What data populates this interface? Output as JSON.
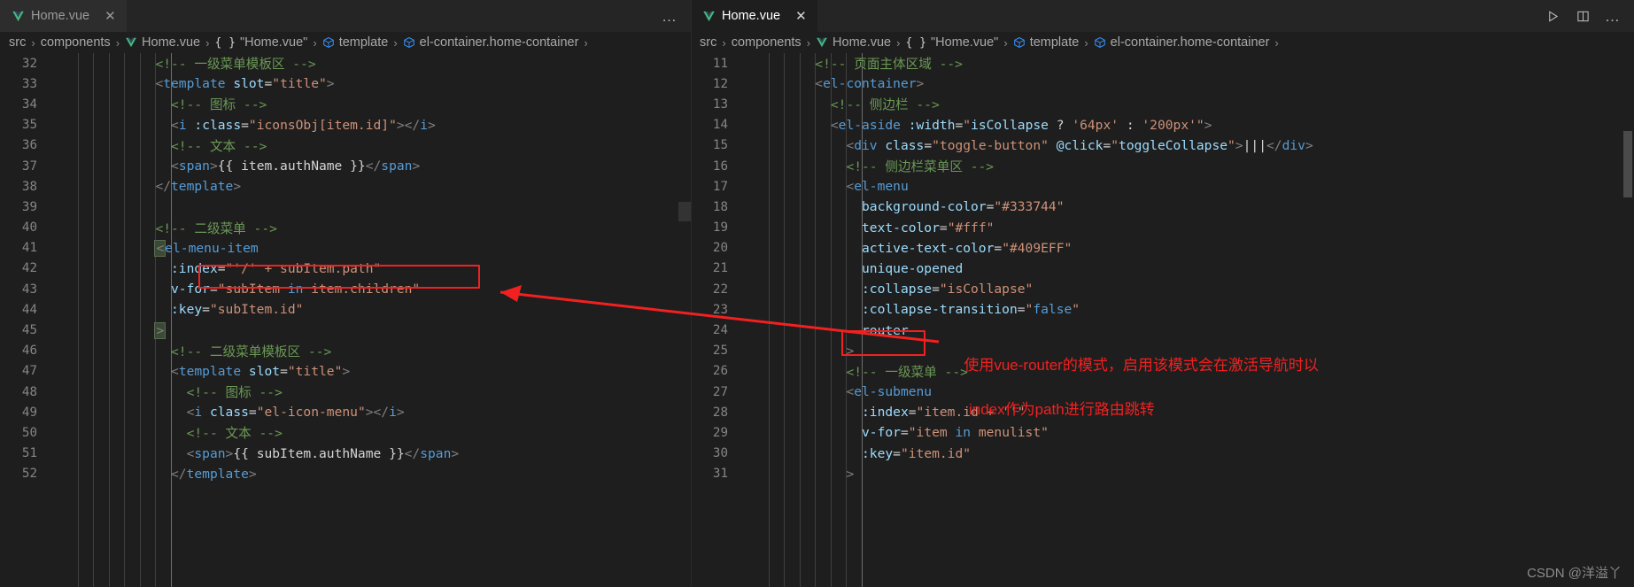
{
  "window": {
    "watermark": "CSDN @洋溢丫"
  },
  "left_group": {
    "tab": {
      "label": "Home.vue",
      "icon": "vue-icon",
      "close": "✕",
      "active": false
    },
    "overflow_dots": "…",
    "breadcrumbs": [
      {
        "label": "src",
        "icon": ""
      },
      {
        "label": "components",
        "icon": ""
      },
      {
        "label": "Home.vue",
        "icon": "vue-icon"
      },
      {
        "label": "\"Home.vue\"",
        "icon": "braces-icon"
      },
      {
        "label": "template",
        "icon": "cube-icon"
      },
      {
        "label": "el-container.home-container",
        "icon": "cube-icon"
      }
    ],
    "breadcrumb_separator": "›",
    "lines": [
      {
        "no": "32",
        "indent": 6,
        "tokens": [
          {
            "t": "comment",
            "s": "<!-- 一级菜单模板区 -->"
          }
        ]
      },
      {
        "no": "33",
        "indent": 6,
        "tokens": [
          {
            "t": "punct",
            "s": "<"
          },
          {
            "t": "tag",
            "s": "template"
          },
          {
            "t": "plain",
            "s": " "
          },
          {
            "t": "attr",
            "s": "slot"
          },
          {
            "t": "op",
            "s": "="
          },
          {
            "t": "str",
            "s": "\"title\""
          },
          {
            "t": "punct",
            "s": ">"
          }
        ]
      },
      {
        "no": "34",
        "indent": 7,
        "tokens": [
          {
            "t": "comment",
            "s": "<!-- 图标 -->"
          }
        ]
      },
      {
        "no": "35",
        "indent": 7,
        "tokens": [
          {
            "t": "punct",
            "s": "<"
          },
          {
            "t": "tag",
            "s": "i"
          },
          {
            "t": "plain",
            "s": " "
          },
          {
            "t": "attr",
            "s": ":class"
          },
          {
            "t": "op",
            "s": "="
          },
          {
            "t": "str",
            "s": "\"iconsObj[item.id]\""
          },
          {
            "t": "punct",
            "s": "></"
          },
          {
            "t": "tag",
            "s": "i"
          },
          {
            "t": "punct",
            "s": ">"
          }
        ]
      },
      {
        "no": "36",
        "indent": 7,
        "tokens": [
          {
            "t": "comment",
            "s": "<!-- 文本 -->"
          }
        ]
      },
      {
        "no": "37",
        "indent": 7,
        "tokens": [
          {
            "t": "punct",
            "s": "<"
          },
          {
            "t": "tag",
            "s": "span"
          },
          {
            "t": "punct",
            "s": ">"
          },
          {
            "t": "plain",
            "s": "{{ item.authName }}"
          },
          {
            "t": "punct",
            "s": "</"
          },
          {
            "t": "tag",
            "s": "span"
          },
          {
            "t": "punct",
            "s": ">"
          }
        ]
      },
      {
        "no": "38",
        "indent": 6,
        "tokens": [
          {
            "t": "punct",
            "s": "</"
          },
          {
            "t": "tag",
            "s": "template"
          },
          {
            "t": "punct",
            "s": ">"
          }
        ]
      },
      {
        "no": "39",
        "indent": 0,
        "tokens": []
      },
      {
        "no": "40",
        "indent": 6,
        "tokens": [
          {
            "t": "comment",
            "s": "<!-- 二级菜单 -->"
          }
        ]
      },
      {
        "no": "41",
        "indent": 6,
        "tokens": [
          {
            "t": "box",
            "s": "<"
          },
          {
            "t": "tag",
            "s": "el-menu-item"
          }
        ]
      },
      {
        "no": "42",
        "indent": 7,
        "tokens": [
          {
            "t": "attr",
            "s": ":index"
          },
          {
            "t": "op",
            "s": "="
          },
          {
            "t": "str",
            "s": "\""
          },
          {
            "t": "strq",
            "s": "'/'"
          },
          {
            "t": "str",
            "s": " + subItem.path\""
          }
        ]
      },
      {
        "no": "43",
        "indent": 7,
        "tokens": [
          {
            "t": "attr",
            "s": "v-for"
          },
          {
            "t": "op",
            "s": "="
          },
          {
            "t": "str",
            "s": "\"subItem "
          },
          {
            "t": "kw",
            "s": "in"
          },
          {
            "t": "str",
            "s": " item.children\""
          }
        ]
      },
      {
        "no": "44",
        "indent": 7,
        "tokens": [
          {
            "t": "attr",
            "s": ":key"
          },
          {
            "t": "op",
            "s": "="
          },
          {
            "t": "str",
            "s": "\"subItem.id\""
          }
        ]
      },
      {
        "no": "45",
        "indent": 6,
        "tokens": [
          {
            "t": "box",
            "s": ">"
          }
        ]
      },
      {
        "no": "46",
        "indent": 7,
        "tokens": [
          {
            "t": "comment",
            "s": "<!-- 二级菜单模板区 -->"
          }
        ]
      },
      {
        "no": "47",
        "indent": 7,
        "tokens": [
          {
            "t": "punct",
            "s": "<"
          },
          {
            "t": "tag",
            "s": "template"
          },
          {
            "t": "plain",
            "s": " "
          },
          {
            "t": "attr",
            "s": "slot"
          },
          {
            "t": "op",
            "s": "="
          },
          {
            "t": "str",
            "s": "\"title\""
          },
          {
            "t": "punct",
            "s": ">"
          }
        ]
      },
      {
        "no": "48",
        "indent": 8,
        "tokens": [
          {
            "t": "comment",
            "s": "<!-- 图标 -->"
          }
        ]
      },
      {
        "no": "49",
        "indent": 8,
        "tokens": [
          {
            "t": "punct",
            "s": "<"
          },
          {
            "t": "tag",
            "s": "i"
          },
          {
            "t": "plain",
            "s": " "
          },
          {
            "t": "attr",
            "s": "class"
          },
          {
            "t": "op",
            "s": "="
          },
          {
            "t": "str",
            "s": "\"el-icon-menu\""
          },
          {
            "t": "punct",
            "s": "></"
          },
          {
            "t": "tag",
            "s": "i"
          },
          {
            "t": "punct",
            "s": ">"
          }
        ]
      },
      {
        "no": "50",
        "indent": 8,
        "tokens": [
          {
            "t": "comment",
            "s": "<!-- 文本 -->"
          }
        ]
      },
      {
        "no": "51",
        "indent": 8,
        "tokens": [
          {
            "t": "punct",
            "s": "<"
          },
          {
            "t": "tag",
            "s": "span"
          },
          {
            "t": "punct",
            "s": ">"
          },
          {
            "t": "plain",
            "s": "{{ subItem.authName }}"
          },
          {
            "t": "punct",
            "s": "</"
          },
          {
            "t": "tag",
            "s": "span"
          },
          {
            "t": "punct",
            "s": ">"
          }
        ]
      },
      {
        "no": "52",
        "indent": 7,
        "tokens": [
          {
            "t": "punct",
            "s": "</"
          },
          {
            "t": "tag",
            "s": "template"
          },
          {
            "t": "punct",
            "s": ">"
          }
        ]
      }
    ],
    "annotation": {
      "red_box_line": "42",
      "red_box_text": ":index=\"'/' + subItem.path\""
    }
  },
  "right_group": {
    "tab": {
      "label": "Home.vue",
      "icon": "vue-icon",
      "close": "✕",
      "active": true
    },
    "actions": [
      {
        "name": "run-icon",
        "glyph": "▷"
      },
      {
        "name": "split-editor-icon",
        "glyph": "▯"
      },
      {
        "name": "more-actions-icon",
        "glyph": "…"
      }
    ],
    "breadcrumbs": [
      {
        "label": "src",
        "icon": ""
      },
      {
        "label": "components",
        "icon": ""
      },
      {
        "label": "Home.vue",
        "icon": "vue-icon"
      },
      {
        "label": "\"Home.vue\"",
        "icon": "braces-icon"
      },
      {
        "label": "template",
        "icon": "cube-icon"
      },
      {
        "label": "el-container.home-container",
        "icon": "cube-icon"
      }
    ],
    "breadcrumb_separator": "›",
    "lines": [
      {
        "no": "11",
        "indent": 4,
        "tokens": [
          {
            "t": "comment",
            "s": "<!-- 页面主体区域 -->"
          }
        ]
      },
      {
        "no": "12",
        "indent": 4,
        "tokens": [
          {
            "t": "punct",
            "s": "<"
          },
          {
            "t": "tag",
            "s": "el-container"
          },
          {
            "t": "punct",
            "s": ">"
          }
        ]
      },
      {
        "no": "13",
        "indent": 5,
        "tokens": [
          {
            "t": "comment",
            "s": "<!-- 侧边栏 -->"
          }
        ]
      },
      {
        "no": "14",
        "indent": 5,
        "tokens": [
          {
            "t": "punct",
            "s": "<"
          },
          {
            "t": "tag",
            "s": "el-aside"
          },
          {
            "t": "plain",
            "s": " "
          },
          {
            "t": "attr",
            "s": ":width"
          },
          {
            "t": "op",
            "s": "="
          },
          {
            "t": "str",
            "s": "\""
          },
          {
            "t": "attr",
            "s": "isCollapse"
          },
          {
            "t": "plain",
            "s": " ? "
          },
          {
            "t": "str",
            "s": "'64px'"
          },
          {
            "t": "plain",
            "s": " : "
          },
          {
            "t": "str",
            "s": "'200px'"
          },
          {
            "t": "str",
            "s": "\""
          },
          {
            "t": "punct",
            "s": ">"
          }
        ]
      },
      {
        "no": "15",
        "indent": 6,
        "tokens": [
          {
            "t": "punct",
            "s": "<"
          },
          {
            "t": "tag",
            "s": "div"
          },
          {
            "t": "plain",
            "s": " "
          },
          {
            "t": "attr",
            "s": "class"
          },
          {
            "t": "op",
            "s": "="
          },
          {
            "t": "str",
            "s": "\"toggle-button\""
          },
          {
            "t": "plain",
            "s": " "
          },
          {
            "t": "attr",
            "s": "@click"
          },
          {
            "t": "op",
            "s": "="
          },
          {
            "t": "str",
            "s": "\""
          },
          {
            "t": "attr",
            "s": "toggleCollapse"
          },
          {
            "t": "str",
            "s": "\""
          },
          {
            "t": "punct",
            "s": ">"
          },
          {
            "t": "plain",
            "s": "|||"
          },
          {
            "t": "punct",
            "s": "</"
          },
          {
            "t": "tag",
            "s": "div"
          },
          {
            "t": "punct",
            "s": ">"
          }
        ]
      },
      {
        "no": "16",
        "indent": 6,
        "tokens": [
          {
            "t": "comment",
            "s": "<!-- 侧边栏菜单区 -->"
          }
        ]
      },
      {
        "no": "17",
        "indent": 6,
        "tokens": [
          {
            "t": "punct",
            "s": "<"
          },
          {
            "t": "tag",
            "s": "el-menu"
          }
        ]
      },
      {
        "no": "18",
        "indent": 7,
        "tokens": [
          {
            "t": "attr",
            "s": "background-color"
          },
          {
            "t": "op",
            "s": "="
          },
          {
            "t": "str",
            "s": "\"#333744\""
          }
        ]
      },
      {
        "no": "19",
        "indent": 7,
        "tokens": [
          {
            "t": "attr",
            "s": "text-color"
          },
          {
            "t": "op",
            "s": "="
          },
          {
            "t": "str",
            "s": "\"#fff\""
          }
        ]
      },
      {
        "no": "20",
        "indent": 7,
        "tokens": [
          {
            "t": "attr",
            "s": "active-text-color"
          },
          {
            "t": "op",
            "s": "="
          },
          {
            "t": "str",
            "s": "\"#409EFF\""
          }
        ]
      },
      {
        "no": "21",
        "indent": 7,
        "tokens": [
          {
            "t": "attr",
            "s": "unique-opened"
          }
        ]
      },
      {
        "no": "22",
        "indent": 7,
        "tokens": [
          {
            "t": "attr",
            "s": ":collapse"
          },
          {
            "t": "op",
            "s": "="
          },
          {
            "t": "str",
            "s": "\"isCollapse\""
          }
        ]
      },
      {
        "no": "23",
        "indent": 7,
        "tokens": [
          {
            "t": "attr",
            "s": ":collapse-transition"
          },
          {
            "t": "op",
            "s": "="
          },
          {
            "t": "str",
            "s": "\""
          },
          {
            "t": "kw",
            "s": "false"
          },
          {
            "t": "str",
            "s": "\""
          }
        ]
      },
      {
        "no": "24",
        "indent": 7,
        "tokens": [
          {
            "t": "attr",
            "s": "router"
          }
        ]
      },
      {
        "no": "25",
        "indent": 6,
        "tokens": [
          {
            "t": "punct",
            "s": ">"
          }
        ]
      },
      {
        "no": "26",
        "indent": 6,
        "tokens": [
          {
            "t": "comment",
            "s": "<!-- 一级菜单 -->"
          }
        ]
      },
      {
        "no": "27",
        "indent": 6,
        "tokens": [
          {
            "t": "punct",
            "s": "<"
          },
          {
            "t": "tag",
            "s": "el-submenu"
          }
        ]
      },
      {
        "no": "28",
        "indent": 7,
        "tokens": [
          {
            "t": "attr",
            "s": ":index"
          },
          {
            "t": "op",
            "s": "="
          },
          {
            "t": "str",
            "s": "\"item.id + ''\""
          }
        ]
      },
      {
        "no": "29",
        "indent": 7,
        "tokens": [
          {
            "t": "attr",
            "s": "v-for"
          },
          {
            "t": "op",
            "s": "="
          },
          {
            "t": "str",
            "s": "\"item "
          },
          {
            "t": "kw",
            "s": "in"
          },
          {
            "t": "str",
            "s": " menulist\""
          }
        ]
      },
      {
        "no": "30",
        "indent": 7,
        "tokens": [
          {
            "t": "attr",
            "s": ":key"
          },
          {
            "t": "op",
            "s": "="
          },
          {
            "t": "str",
            "s": "\"item.id\""
          }
        ]
      },
      {
        "no": "31",
        "indent": 6,
        "tokens": [
          {
            "t": "punct",
            "s": ">"
          }
        ]
      }
    ],
    "annotation": {
      "red_box_line": "24",
      "red_box_text": "router",
      "note_line1": "使用vue-router的模式，启用该模式会在激活导航时以",
      "note_line2": "index作为path进行路由跳转",
      "arrow": "red-arrow-pointing-left"
    }
  },
  "colors": {
    "editor_background": "#1e1e1e",
    "tabbar_background": "#252526",
    "inactive_tab": "#2d2d2d",
    "annotation_red": "#f32020",
    "comment_green": "#6a9955",
    "tag_blue": "#569cd6",
    "attr_blue": "#9cdcfe",
    "string_orange": "#ce9178"
  }
}
